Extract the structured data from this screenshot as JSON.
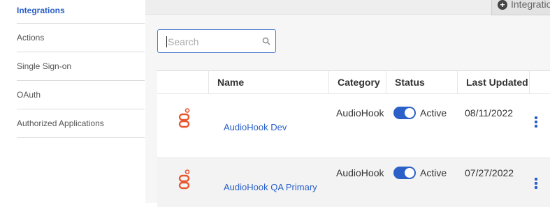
{
  "sidebar": {
    "items": [
      {
        "label": "Integrations",
        "active": true
      },
      {
        "label": "Actions"
      },
      {
        "label": "Single Sign-on"
      },
      {
        "label": "OAuth"
      },
      {
        "label": "Authorized Applications"
      }
    ]
  },
  "topbar": {
    "tab_label": "Integratio",
    "tab_icon": "plus-circle-icon"
  },
  "search": {
    "placeholder": "Search",
    "value": "",
    "icon": "search-icon"
  },
  "table": {
    "columns": [
      "",
      "Name",
      "Category",
      "Status",
      "Last Updated"
    ],
    "rows": [
      {
        "logo": "audiohook-logo-icon",
        "name": "AudioHook Dev",
        "category": "AudioHook",
        "status": "Active",
        "enabled": true,
        "last_updated": "08/11/2022"
      },
      {
        "logo": "audiohook-logo-icon",
        "name": "AudioHook QA Primary",
        "category": "AudioHook",
        "status": "Active",
        "enabled": true,
        "last_updated": "07/27/2022"
      }
    ]
  },
  "colors": {
    "accent": "#2a60c8",
    "logo": "#e8572e"
  }
}
